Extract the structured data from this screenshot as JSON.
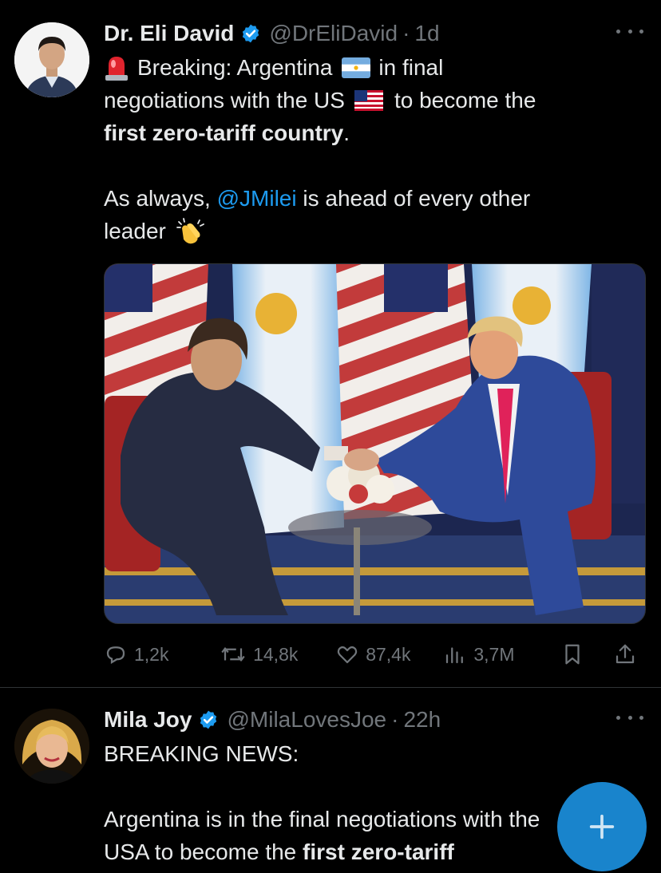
{
  "tweets": [
    {
      "name": "Dr. Eli David",
      "handle": "@DrEliDavid",
      "separator": "·",
      "time": "1d",
      "lines": {
        "l1_a": "Breaking: Argentina",
        "l1_b": "in final",
        "l2_a": "negotiations with the US",
        "l2_b": "to become the",
        "l3_bold": "first zero-tariff country",
        "l3_rest": ".",
        "l5_a": "As always, ",
        "l5_mention": "@JMilei",
        "l5_b": " is ahead of every other",
        "l6": "leader"
      },
      "stats": {
        "replies": "1,2k",
        "reposts": "14,8k",
        "likes": "87,4k",
        "views": "3,7M"
      },
      "icons": [
        "rotating-light-emoji",
        "argentina-flag-emoji",
        "us-flag-emoji",
        "clapping-hands-emoji"
      ]
    },
    {
      "name": "Mila Joy",
      "handle": "@MilaLovesJoe",
      "separator": "·",
      "time": "22h",
      "lines": {
        "l1": "BREAKING NEWS:",
        "l3": "Argentina is in the final negotiations with the",
        "l4_a": "USA to become the ",
        "l4_bold": "first zero-tariff"
      }
    }
  ],
  "colors": {
    "background": "#000000",
    "text": "#e7e9ea",
    "secondary": "#71767b",
    "accent": "#1d9bf0",
    "divider": "#2f3336"
  }
}
